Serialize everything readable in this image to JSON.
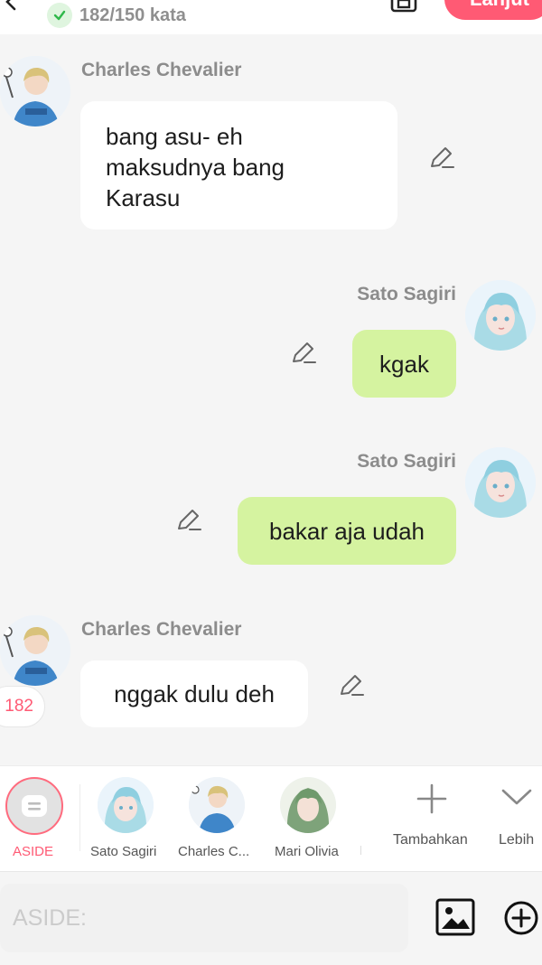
{
  "header": {
    "word_count": "182/150 kata",
    "next_label": "Lanjut"
  },
  "messages": [
    {
      "sender": "Charles Chevalier",
      "text": "bang asu- eh\nmaksudnya bang\nKarasu",
      "side": "left"
    },
    {
      "sender": "Sato Sagiri",
      "text": "kgak",
      "side": "right"
    },
    {
      "sender": "Sato Sagiri",
      "text": "bakar aja udah",
      "side": "right"
    },
    {
      "sender": "Charles Chevalier",
      "text": "nggak dulu deh",
      "side": "left"
    }
  ],
  "side_badge": "182",
  "characters": [
    {
      "label": "ASIDE",
      "active": true
    },
    {
      "label": "Sato Sagiri"
    },
    {
      "label": "Charles C..."
    },
    {
      "label": "Mari Olivia"
    }
  ],
  "actions": {
    "add_label": "Tambahkan",
    "more_label": "Lebih"
  },
  "input": {
    "placeholder": "ASIDE:"
  },
  "icons": [
    "back-icon",
    "check-icon",
    "save-icon",
    "edit-icon",
    "aside-icon",
    "plus-icon",
    "chevron-down-icon",
    "image-icon",
    "plus-circle-icon"
  ],
  "colors": {
    "accent": "#ff5a74",
    "bubble_right": "#d5f3a0",
    "bubble_left": "#ffffff"
  }
}
